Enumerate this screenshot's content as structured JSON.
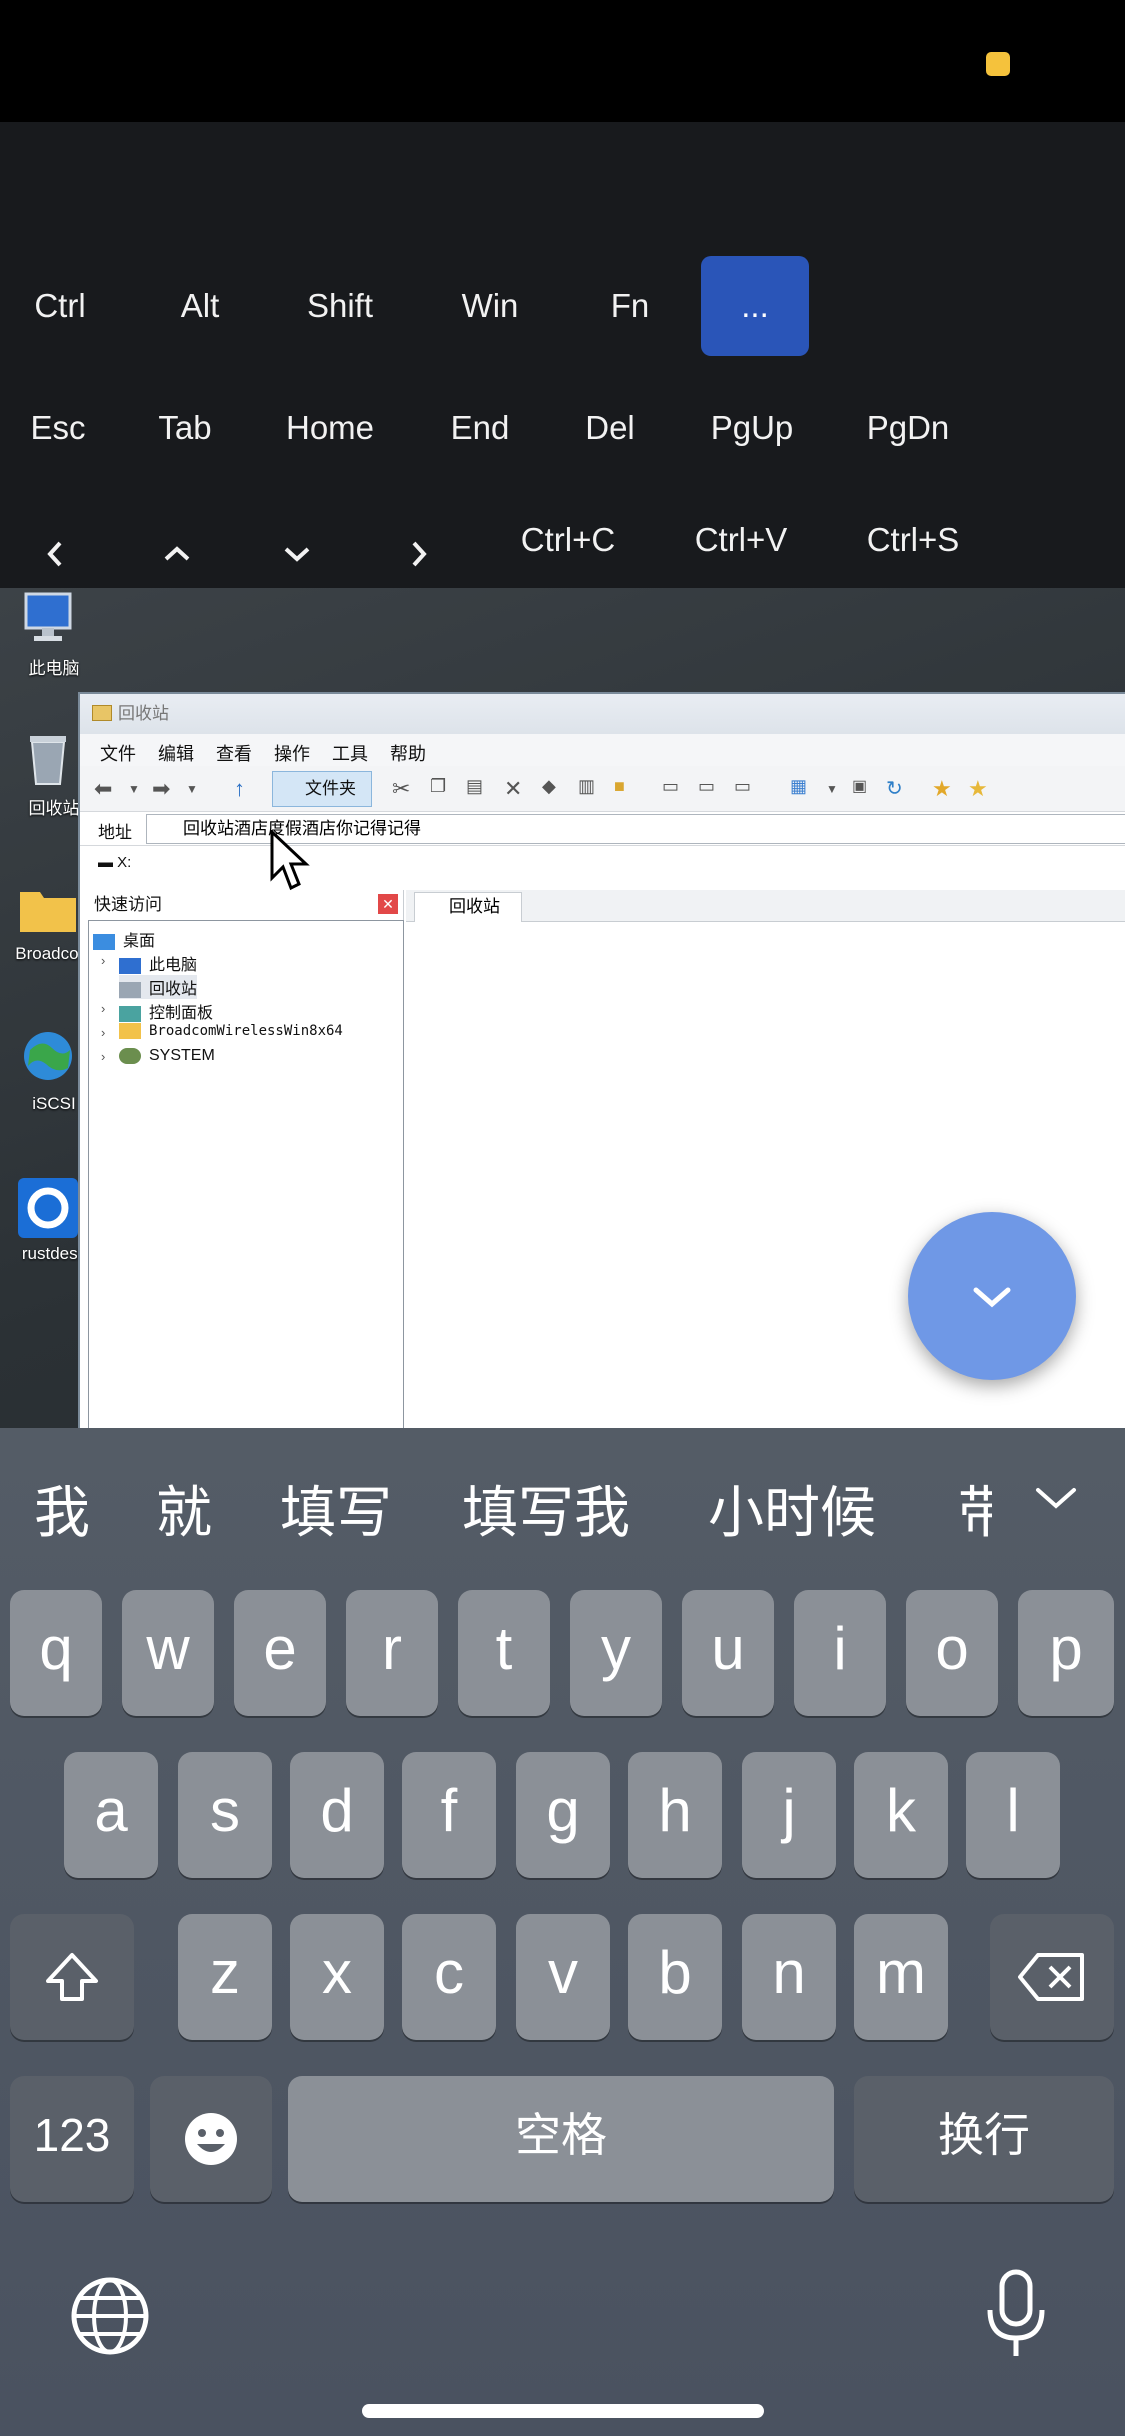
{
  "modifier_row": [
    "Ctrl",
    "Alt",
    "Shift",
    "Win",
    "Fn",
    "..."
  ],
  "nav_row": [
    "Esc",
    "Tab",
    "Home",
    "End",
    "Del",
    "PgUp",
    "PgDn"
  ],
  "shortcut_row": [
    "Ctrl+C",
    "Ctrl+V",
    "Ctrl+S"
  ],
  "desktop_icons": [
    "此电脑",
    "回收站",
    "Broadcom",
    "iSCSI",
    "rustdesk"
  ],
  "explorer": {
    "title": "回收站",
    "menu": [
      "文件",
      "编辑",
      "查看",
      "操作",
      "工具",
      "帮助"
    ],
    "folder_button": "文件夹",
    "address_label": "地址",
    "address_value": "回收站酒店度假酒店你记得记得",
    "drive": "X:",
    "quick_access": "快速访问",
    "tree": [
      "桌面",
      "此电脑",
      "回收站",
      "控制面板",
      "BroadcomWirelessWin8x64",
      "SYSTEM"
    ],
    "tab": "回收站"
  },
  "candidates": [
    "我",
    "就",
    "填写",
    "填写我",
    "小时候",
    "带"
  ],
  "keys": {
    "row1": [
      "q",
      "w",
      "e",
      "r",
      "t",
      "y",
      "u",
      "i",
      "o",
      "p"
    ],
    "row2": [
      "a",
      "s",
      "d",
      "f",
      "g",
      "h",
      "j",
      "k",
      "l"
    ],
    "row3": [
      "z",
      "x",
      "c",
      "v",
      "b",
      "n",
      "m"
    ],
    "numbers": "123",
    "space": "空格",
    "return": "换行"
  },
  "colors": {
    "accent": "#2a55b8",
    "fab": "#6f98e6",
    "status_dot": "#f5c23c"
  }
}
